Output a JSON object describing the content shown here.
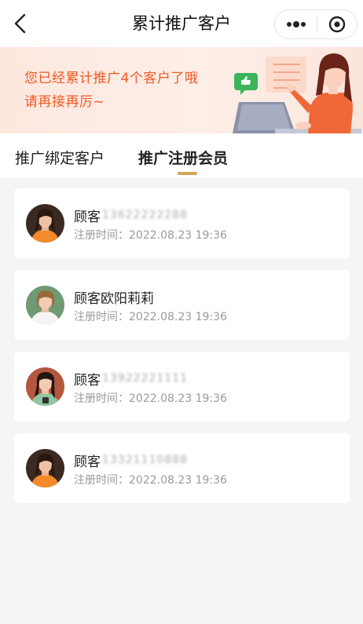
{
  "header": {
    "title": "累计推广客户"
  },
  "banner": {
    "line1": "您已经累计推广4个客户了哦",
    "line2": "请再接再厉~"
  },
  "tabs": [
    {
      "label": "推广绑定客户",
      "active": false
    },
    {
      "label": "推广注册会员",
      "active": true
    }
  ],
  "customers": [
    {
      "name": "顾客",
      "masked": "13622222288",
      "reg_label": "注册时间：",
      "reg_time": "2022.08.23 19:36",
      "avatar": "woman-orange-shirt"
    },
    {
      "name": "顾客欧阳莉莉",
      "masked": "",
      "reg_label": "注册时间：",
      "reg_time": "2022.08.23 19:36",
      "avatar": "woman-white-shirt"
    },
    {
      "name": "顾客",
      "masked": "13922221111",
      "reg_label": "注册时间：",
      "reg_time": "2022.08.23 19:36",
      "avatar": "woman-green-shirt"
    },
    {
      "name": "顾客",
      "masked": "13321110888",
      "reg_label": "注册时间：",
      "reg_time": "2022.08.23 19:36",
      "avatar": "woman-orange-shirt"
    }
  ],
  "colors": {
    "accent_orange": "#f05a23",
    "tab_underline": "#d3a25b",
    "page_bg": "#f5f5f7"
  }
}
